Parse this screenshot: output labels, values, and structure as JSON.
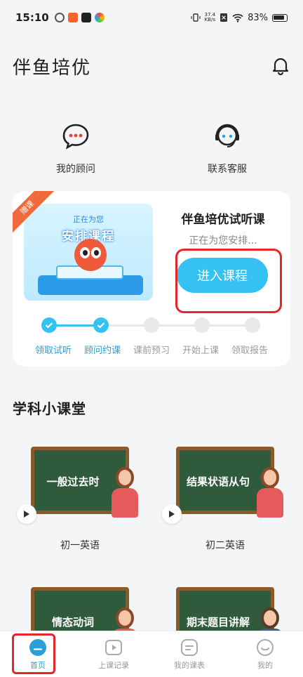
{
  "status_bar": {
    "time": "15:10",
    "net_speed_value": "37.4",
    "net_speed_unit": "KB/s",
    "battery": "83%"
  },
  "header": {
    "title": "伴鱼培优"
  },
  "quick": {
    "advisor_label": "我的顾问",
    "service_label": "联系客服"
  },
  "trial_card": {
    "ribbon": "赠课",
    "banner_subtitle": "正在为您",
    "banner_title": "安排课程",
    "title": "伴鱼培优试听课",
    "status": "正在为您安排...",
    "enter_button": "进入课程",
    "steps": [
      {
        "label": "领取试听",
        "done": true
      },
      {
        "label": "顾问约课",
        "done": true
      },
      {
        "label": "课前预习",
        "done": false
      },
      {
        "label": "开始上课",
        "done": false
      },
      {
        "label": "领取报告",
        "done": false
      }
    ]
  },
  "section": {
    "title": "学科小课堂",
    "courses": [
      {
        "board_text": "一般过去时",
        "label": "初一英语"
      },
      {
        "board_text": "结果状语从句",
        "label": "初二英语"
      },
      {
        "board_text": "情态动词",
        "label": ""
      },
      {
        "board_text": "期末题目讲解",
        "label": ""
      }
    ]
  },
  "bottom_nav": {
    "items": [
      {
        "label": "首页",
        "active": true
      },
      {
        "label": "上课记录",
        "active": false
      },
      {
        "label": "我的课表",
        "active": false
      },
      {
        "label": "我的",
        "active": false
      }
    ]
  },
  "colors": {
    "accent": "#35c1f1",
    "accent_text": "#2a9fd8",
    "highlight": "#e2262a",
    "ribbon": "#f06a3b"
  }
}
